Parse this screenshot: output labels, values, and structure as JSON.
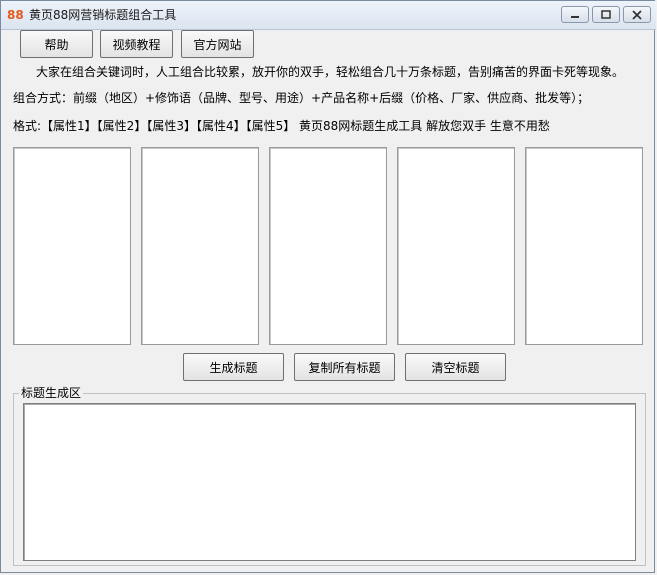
{
  "window": {
    "icon_text": "88",
    "title": "黄页88网营销标题组合工具"
  },
  "toolbar": {
    "help_label": "帮助",
    "video_label": "视频教程",
    "site_label": "官方网站"
  },
  "info": {
    "line1": "大家在组合关键词时，人工组合比较累，放开你的双手，轻松组合几十万条标题，告别痛苦的界面卡死等现象。",
    "line2": "组合方式：前缀（地区）+修饰语（品牌、型号、用途）+产品名称+后缀（价格、厂家、供应商、批发等）；",
    "line3": "格式:【属性1】【属性2】【属性3】【属性4】【属性5】 黄页88网标题生成工具 解放您双手 生意不用愁"
  },
  "actions": {
    "generate_label": "生成标题",
    "copy_label": "复制所有标题",
    "clear_label": "清空标题"
  },
  "output": {
    "group_label": "标题生成区"
  },
  "colors": {
    "icon_accent": "#e25a1c"
  }
}
